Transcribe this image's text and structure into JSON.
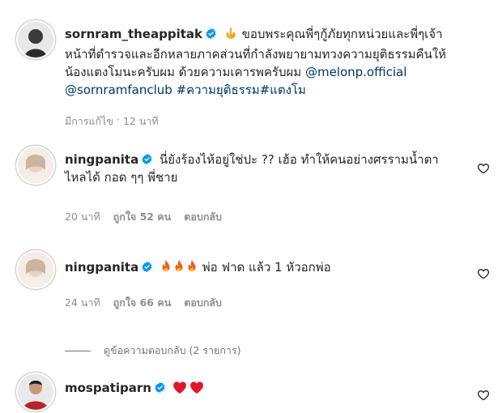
{
  "post": {
    "username": "sornram_theappitak",
    "caption_line1": "ขอบพระคุณพี่ๆกู้ภัยทุกหน่วยและพี่ๆเจ้า",
    "caption_line2": "หน้าที่ตำรวจและอีกหลายภาคส่วนที่กำลังพยายามทวงความยุติธรรมคืนให้",
    "caption_line3": "น้องแตงโมนะครับผม ด้วยความเคารพครับผม",
    "mention1": "@melonp.official",
    "mention2": "@sornramfanclub",
    "hashtags": "#ความยุติธรรม#แตงโม",
    "edited": "มีการแก้ไข",
    "time": "12 นาที"
  },
  "comments": [
    {
      "username": "ningpanita",
      "text_line1": "นี่ยังร้องไห้อยู่ใช่ปะ ?? เฮ้อ ทำให้คนอย่างศรรามน้ำตา",
      "text_line2": "ไหลได้ กอด ๆๆ พี่ชาย",
      "time": "20 นาที",
      "likes": "ถูกใจ 52 คน",
      "reply": "ตอบกลับ"
    },
    {
      "username": "ningpanita",
      "text_line1": "พ่อ ฟาด แล้ว 1 หัวอกพ่อ",
      "time": "24 นาที",
      "likes": "ถูกใจ 66 คน",
      "reply": "ตอบกลับ"
    },
    {
      "username": "mospatiparn"
    }
  ],
  "view_replies": "ดูข้อความตอบกลับ (2 รายการ)",
  "icons": {
    "verified": "verified-badge-icon",
    "like": "heart-outline-icon",
    "pray": "folded-hands-emoji",
    "fire": "fire-emoji",
    "red_heart": "red-heart-emoji"
  },
  "colors": {
    "verified": "#0095f6",
    "mention": "#00376b",
    "muted": "#8e8e8e"
  }
}
